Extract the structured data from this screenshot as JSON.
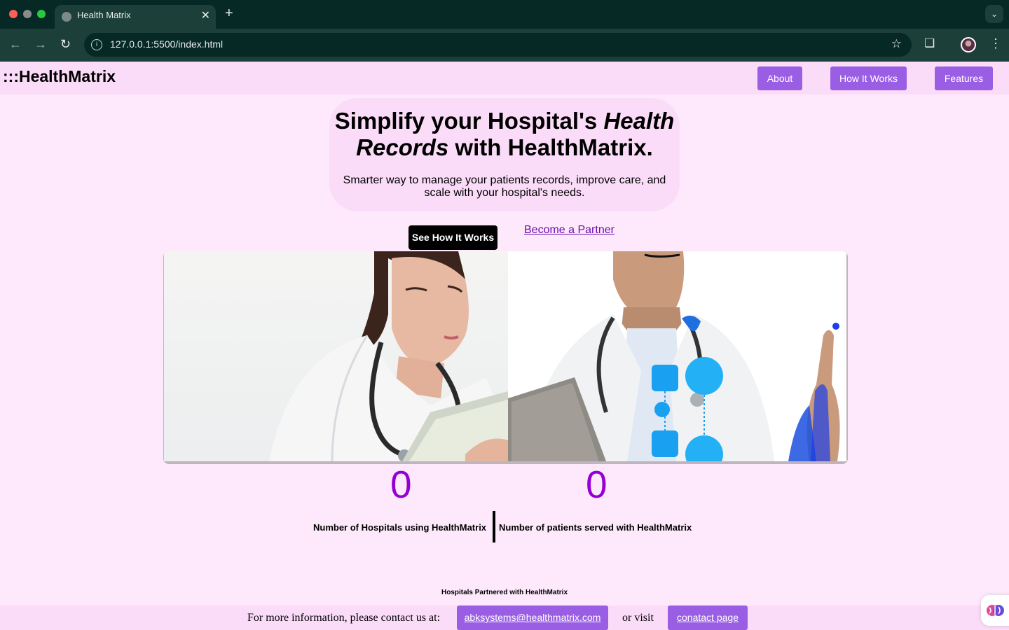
{
  "browser": {
    "tab_title": "Health Matrix",
    "tab_close": "✕",
    "new_tab": "+",
    "url": "127.0.0.1:5500/index.html"
  },
  "header": {
    "logo": ":::HealthMatrix",
    "nav": [
      "About",
      "How It Works",
      "Features"
    ]
  },
  "hero": {
    "title_part1": "Simplify your Hospital's ",
    "title_emph": "Health Records",
    "title_part2": " with HealthMatrix.",
    "subtitle": "Smarter way to manage your patients records, improve care, and scale with your hospital's needs.",
    "cta_label": "See How It Works",
    "partner_link": "Become a Partner"
  },
  "stats": {
    "hospitals_count": "0",
    "hospitals_label": "Number of Hospitals using HealthMatrix",
    "patients_count": "0",
    "patients_label": "Number of patients served with HealthMatrix"
  },
  "partners_heading": "Hospitals Partnered with HealthMatrix",
  "footer": {
    "lead": "For more information, please contact us at:",
    "email": "abksystems@healthmatrix.com",
    "or_visit": "or visit",
    "contact_link": "conatact page"
  },
  "colors": {
    "accent": "#9a5ee4",
    "stat_number": "#9400d3",
    "page_bg": "#fde9fb",
    "header_bg": "#fbdcf8"
  }
}
